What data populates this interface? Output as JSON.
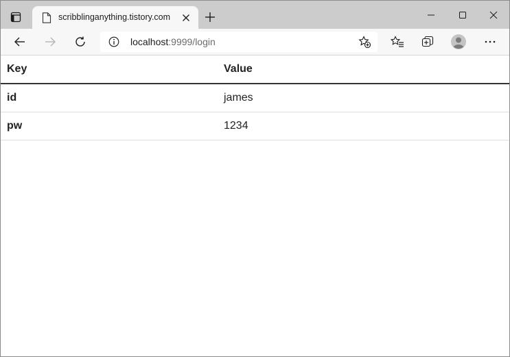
{
  "browser": {
    "tab": {
      "title": "scribblinganything.tistory.com",
      "favicon": "page-icon"
    },
    "address": {
      "host": "localhost",
      "rest": ":9999/login"
    },
    "icons": {
      "tab_actions": "tab-actions-icon",
      "tab_close": "close-icon",
      "new_tab": "plus-icon",
      "minimize": "minimize-icon",
      "maximize": "maximize-icon",
      "close": "window-close-icon",
      "back": "back-arrow-icon",
      "forward": "forward-arrow-icon",
      "reload": "reload-icon",
      "site_info": "info-icon",
      "add_favorite": "add-favorite-icon",
      "favorites": "favorites-icon",
      "collections": "collections-icon",
      "profile": "profile-avatar-icon",
      "more": "more-icon"
    }
  },
  "table": {
    "headers": {
      "key": "Key",
      "value": "Value"
    },
    "rows": [
      {
        "key": "id",
        "value": "james"
      },
      {
        "key": "pw",
        "value": "1234"
      }
    ]
  },
  "colors": {
    "tabstrip": "#cccccc",
    "toolbar": "#f7f7f7",
    "header_rule": "#333333",
    "row_rule": "#dddddd"
  }
}
